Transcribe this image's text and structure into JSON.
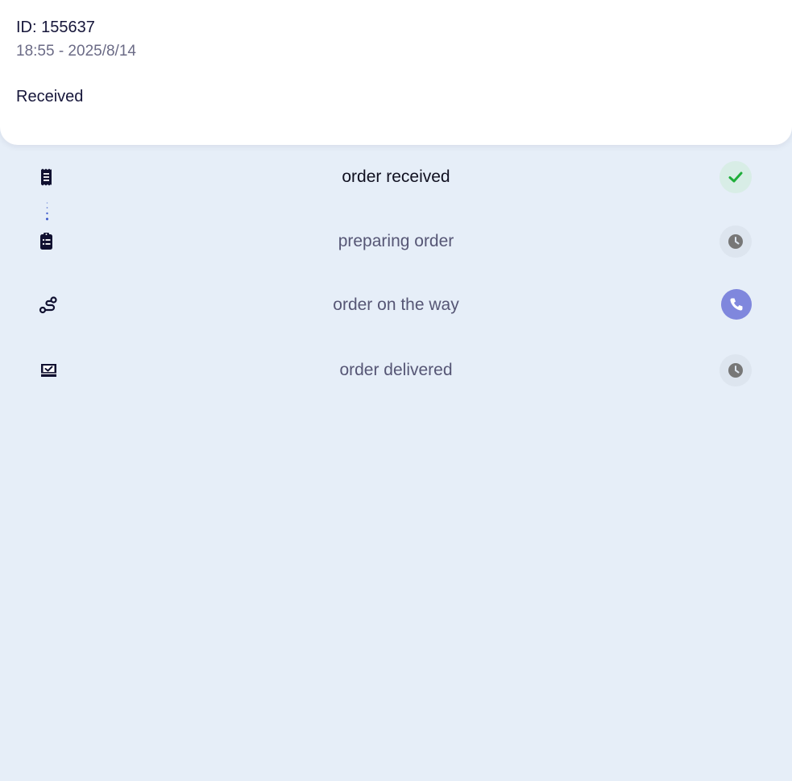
{
  "order": {
    "id_text": "ID: 155637",
    "time_text": "18:55 - 2025/8/14",
    "status_text": "Received"
  },
  "steps": [
    {
      "label": "order received",
      "icon": "receipt-icon",
      "state": "done"
    },
    {
      "label": "preparing order",
      "icon": "clipboard-list-icon",
      "state": "pending"
    },
    {
      "label": "order on the way",
      "icon": "route-icon",
      "state": "call"
    },
    {
      "label": "order delivered",
      "icon": "delivered-box-icon",
      "state": "pending"
    }
  ],
  "colors": {
    "background": "#e6eef8",
    "card": "#ffffff",
    "done_check": "#1fae3a",
    "pending_clock": "#777777",
    "call_button": "#7f87dd",
    "connector_dots": "#3a56c9"
  }
}
